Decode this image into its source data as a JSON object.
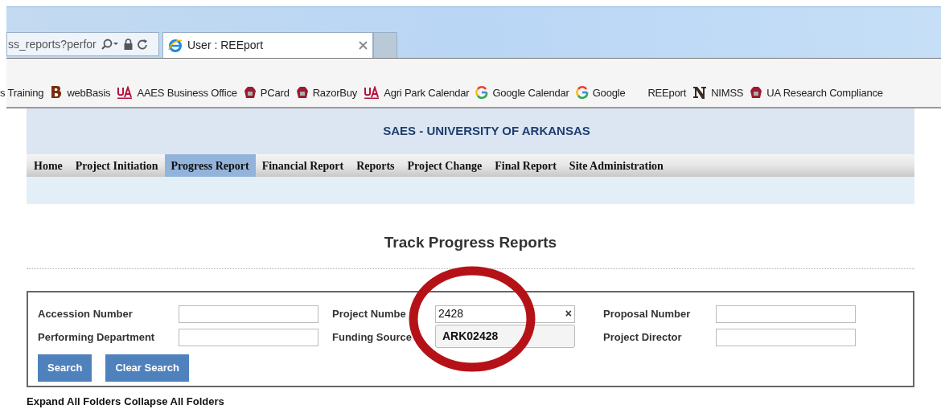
{
  "browser": {
    "address": "ss_reports?perfor",
    "tab": {
      "title": "User : REEport",
      "selected": true
    }
  },
  "bookmarks": [
    {
      "label": "s Training",
      "kind": "none"
    },
    {
      "label": "webBasis",
      "kind": "b"
    },
    {
      "label": "AAES Business Office",
      "kind": "ua"
    },
    {
      "label": "PCard",
      "kind": "hog"
    },
    {
      "label": "RazorBuy",
      "kind": "hog"
    },
    {
      "label": "Agri Park Calendar",
      "kind": "ua"
    },
    {
      "label": "Google Calendar",
      "kind": "g"
    },
    {
      "label": "Google",
      "kind": "g"
    },
    {
      "label": "REEport",
      "kind": "none"
    },
    {
      "label": "NIMSS",
      "kind": "n"
    },
    {
      "label": "UA Research Compliance",
      "kind": "hog"
    }
  ],
  "site_title": "SAES - UNIVERSITY OF ARKANSAS",
  "nav": [
    {
      "label": "Home",
      "selected": false
    },
    {
      "label": "Project Initiation",
      "selected": false
    },
    {
      "label": "Progress Report",
      "selected": true
    },
    {
      "label": "Financial Report",
      "selected": false
    },
    {
      "label": "Reports",
      "selected": false
    },
    {
      "label": "Project Change",
      "selected": false
    },
    {
      "label": "Final Report",
      "selected": false
    },
    {
      "label": "Site Administration",
      "selected": false
    }
  ],
  "page_title": "Track Progress Reports",
  "form": {
    "rows": [
      [
        {
          "label": "Accession Number"
        },
        {
          "label": "Project Numbe",
          "value": "2428",
          "clear": "×"
        },
        {
          "label": "Proposal Number"
        }
      ],
      [
        {
          "label": "Performing Department"
        },
        {
          "label": "Funding Source"
        },
        {
          "label": "Project Director"
        }
      ]
    ],
    "suggestion": "ARK02428",
    "buttons": [
      "Search",
      "Clear Search"
    ]
  },
  "folder_links": [
    "Expand All Folders",
    "Collapse All Folders"
  ]
}
